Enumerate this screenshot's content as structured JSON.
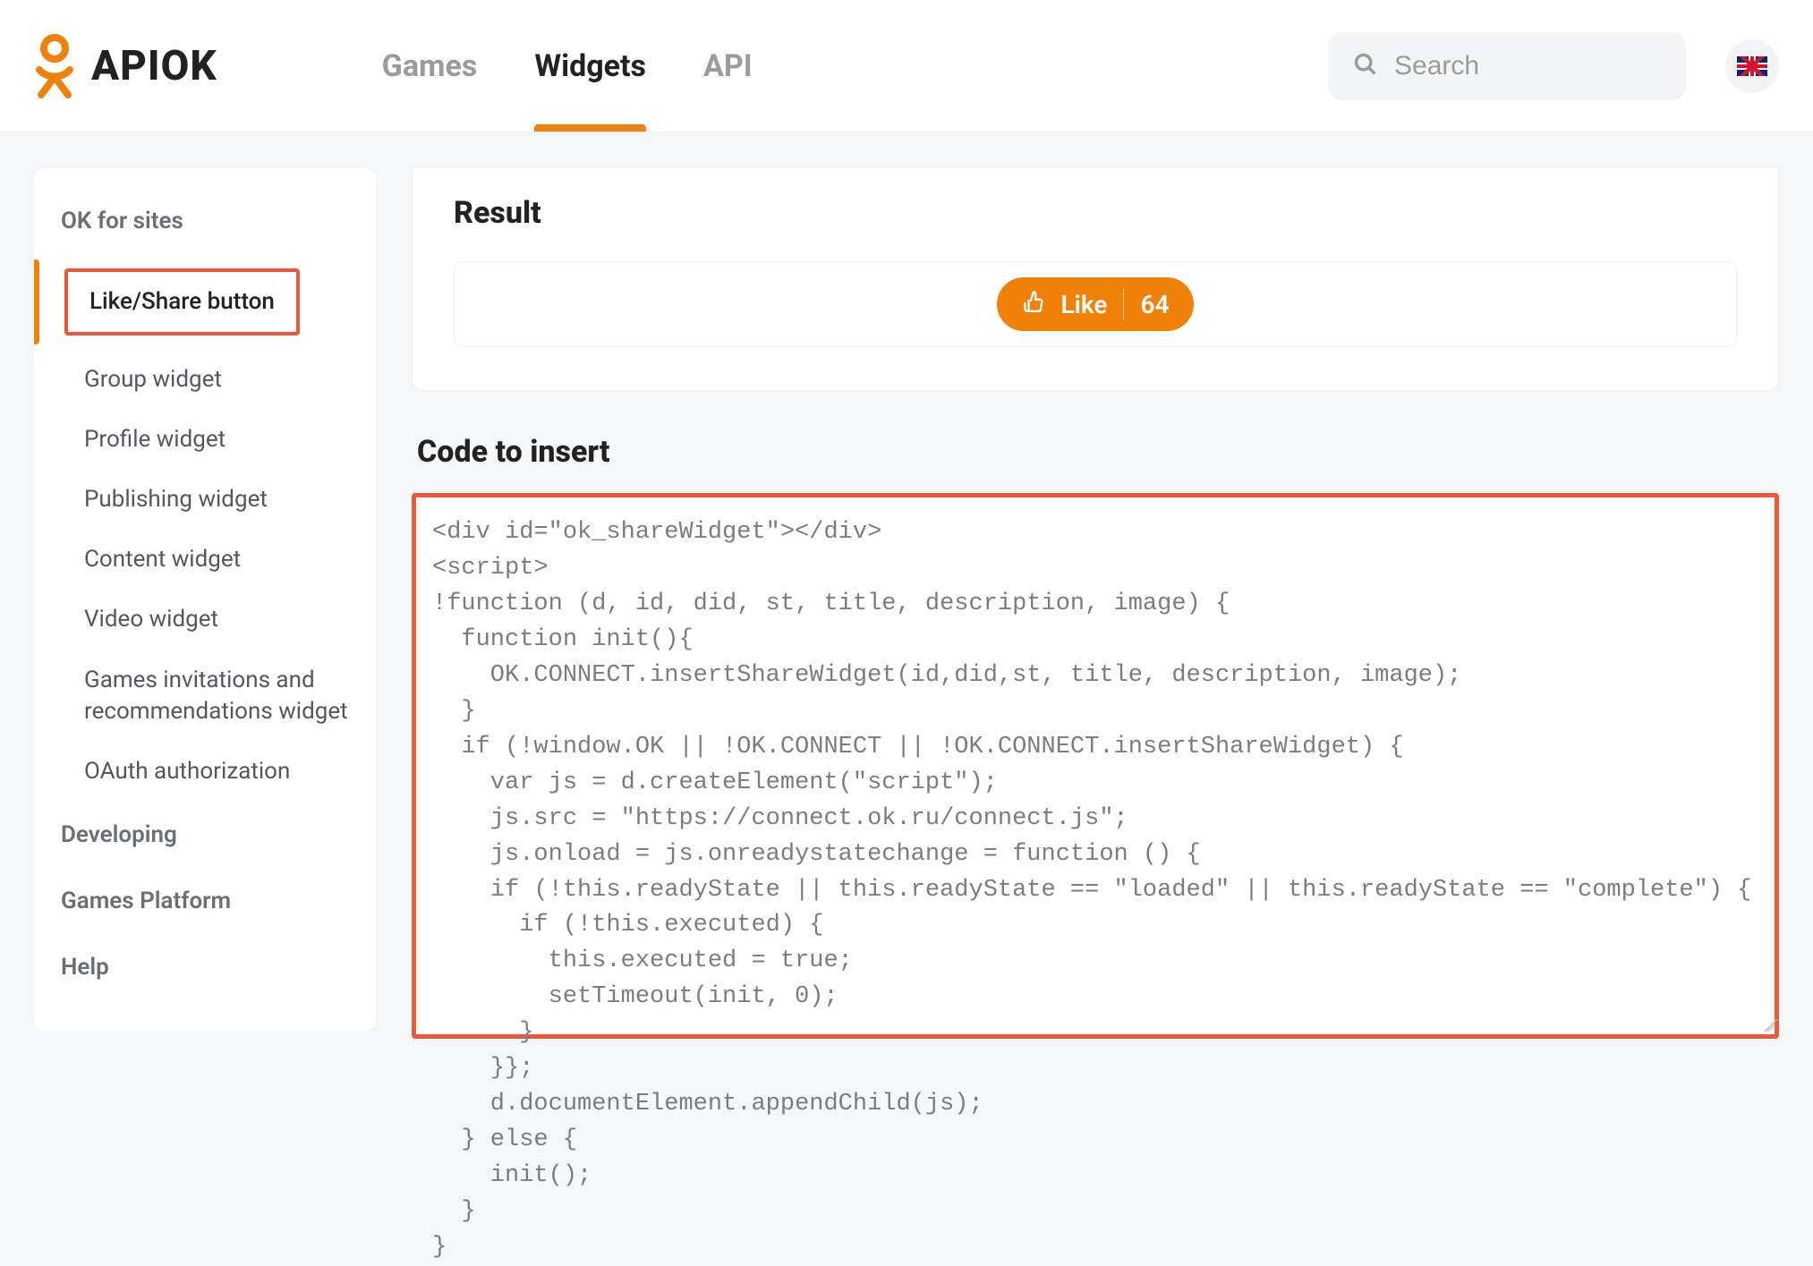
{
  "header": {
    "brand": "APIOK",
    "nav": {
      "games": "Games",
      "widgets": "Widgets",
      "api": "API"
    },
    "search_placeholder": "Search"
  },
  "sidebar": {
    "section1_title": "OK for sites",
    "items": [
      "Like/Share button",
      "Group widget",
      "Profile widget",
      "Publishing widget",
      "Content widget",
      "Video widget",
      "Games invitations and recommendations widget",
      "OAuth authorization"
    ],
    "plain": [
      "Developing",
      "Games Platform",
      "Help"
    ]
  },
  "main": {
    "result_title": "Result",
    "like_label": "Like",
    "like_count": "64",
    "code_title": "Code to insert",
    "code": "<div id=\"ok_shareWidget\"></div>\n<script>\n!function (d, id, did, st, title, description, image) {\n  function init(){\n    OK.CONNECT.insertShareWidget(id,did,st, title, description, image);\n  }\n  if (!window.OK || !OK.CONNECT || !OK.CONNECT.insertShareWidget) {\n    var js = d.createElement(\"script\");\n    js.src = \"https://connect.ok.ru/connect.js\";\n    js.onload = js.onreadystatechange = function () {\n    if (!this.readyState || this.readyState == \"loaded\" || this.readyState == \"complete\") {\n      if (!this.executed) {\n        this.executed = true;\n        setTimeout(init, 0);\n      }\n    }};\n    d.documentElement.appendChild(js);\n  } else {\n    init();\n  }\n}"
  }
}
